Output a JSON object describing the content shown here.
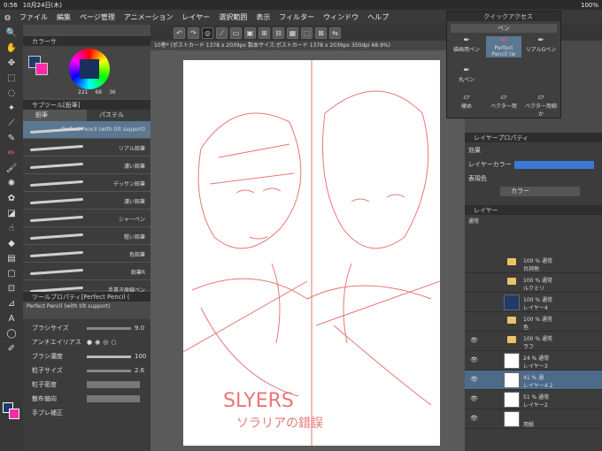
{
  "status": {
    "time": "0:56",
    "date": "10月24日(木)"
  },
  "menu": [
    "ファイル",
    "編集",
    "ページ管理",
    "アニメーション",
    "レイヤー",
    "選択範囲",
    "表示",
    "フィルター",
    "ウィンドウ",
    "ヘルプ"
  ],
  "document_tab": "10巻* (ポストカード 1378 x 2039px 製本サイズ:ポストカード 1378 x 2039px 350dpi 68.9%)",
  "color_panel": {
    "title": "カラーサ",
    "values": [
      "221",
      "68",
      "36"
    ],
    "main_color": "#1f3a6b",
    "sub_color": "#ff2aa8"
  },
  "subtool": {
    "title": "サブツール[鉛筆]",
    "tabs": [
      "鉛筆",
      "パステル"
    ],
    "brushes": [
      "Perfect Pencil (with tilt support)",
      "リアル鉛筆",
      "濃い鉛筆",
      "デッサン鉛筆",
      "濃い鉛筆",
      "シャーペン",
      "粗い鉛筆",
      "色鉛筆",
      "鉛筆R",
      "手書き原線ペン"
    ]
  },
  "tool_property": {
    "title": "ツールプロパティ[Perfect Pencil (",
    "tool_name": "Perfect Pencil (with tilt support)",
    "rows": [
      {
        "label": "ブラシサイズ",
        "value": "9.0"
      },
      {
        "label": "アンチエイリアス",
        "value": ""
      },
      {
        "label": "ブラシ濃度",
        "value": "100"
      },
      {
        "label": "粒子サイズ",
        "value": "2.6"
      },
      {
        "label": "粒子密度",
        "value": ""
      },
      {
        "label": "散布偏向",
        "value": ""
      },
      {
        "label": "手ブレ補正",
        "value": ""
      }
    ]
  },
  "quick_access": {
    "title": "クイックアクセス",
    "category": "ペン",
    "items": [
      "描画用ペン",
      "Perfect Pencil (w",
      "リアルGペン",
      "丸ペン",
      "硬め",
      "ベクター用",
      "ベクター用細か"
    ]
  },
  "layer_property": {
    "title": "レイヤープロパティ",
    "effect_label": "効果",
    "layer_color_label": "レイヤーカラー",
    "expression_label": "表現色",
    "expression_value": "カラー",
    "layer_color": "#3a79d8"
  },
  "layers": {
    "title": "レイヤー",
    "blend": "通常",
    "rows": [
      {
        "line1": "100 % 通常",
        "line2": "台詞他",
        "type": "folder"
      },
      {
        "line1": "100 % 通常",
        "line2": "ルクミリ",
        "type": "folder"
      },
      {
        "line1": "100 % 通常",
        "line2": "レイヤー4",
        "type": "layer"
      },
      {
        "line1": "100 % 通常",
        "line2": "色",
        "type": "folder"
      },
      {
        "line1": "100 % 通常",
        "line2": "ラフ",
        "type": "folder"
      },
      {
        "line1": "24 % 通常",
        "line2": "レイヤー3",
        "type": "layer"
      },
      {
        "line1": "41 % 通",
        "line2": "レイヤー4 2",
        "type": "layer",
        "selected": true
      },
      {
        "line1": "51 % 通常",
        "line2": "レイヤー2",
        "type": "layer"
      },
      {
        "line1": "",
        "line2": "用紙",
        "type": "paper"
      }
    ]
  },
  "battery": "100%"
}
